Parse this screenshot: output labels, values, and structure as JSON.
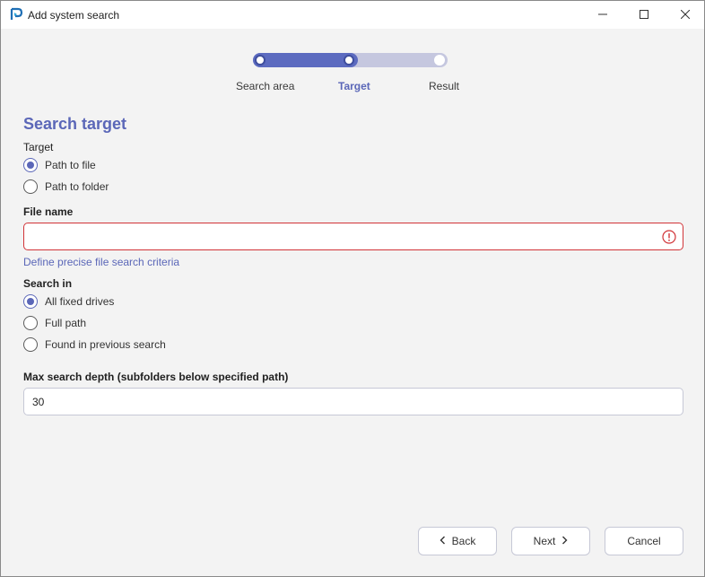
{
  "window": {
    "title": "Add system search"
  },
  "stepper": {
    "steps": [
      "Search area",
      "Target",
      "Result"
    ],
    "current_step": 2
  },
  "form": {
    "heading": "Search target",
    "target_label": "Target",
    "target_options": [
      {
        "label": "Path to file",
        "checked": true
      },
      {
        "label": "Path to folder",
        "checked": false
      }
    ],
    "file_name_label": "File name",
    "file_name_value": "",
    "file_name_error": true,
    "define_criteria_link": "Define precise file search criteria",
    "search_in_label": "Search in",
    "search_in_options": [
      {
        "label": "All fixed drives",
        "checked": true
      },
      {
        "label": "Full path",
        "checked": false
      },
      {
        "label": "Found in previous search",
        "checked": false
      }
    ],
    "max_depth_label": "Max search depth (subfolders below specified path)",
    "max_depth_value": "30"
  },
  "buttons": {
    "back": "Back",
    "next": "Next",
    "cancel": "Cancel"
  },
  "colors": {
    "accent": "#5b67b8",
    "error": "#d13438",
    "step_track": "#c5c7df"
  },
  "icons": [
    "app-logo-icon",
    "minimize-icon",
    "maximize-icon",
    "close-icon",
    "error-icon",
    "chevron-left-icon",
    "chevron-right-icon"
  ]
}
